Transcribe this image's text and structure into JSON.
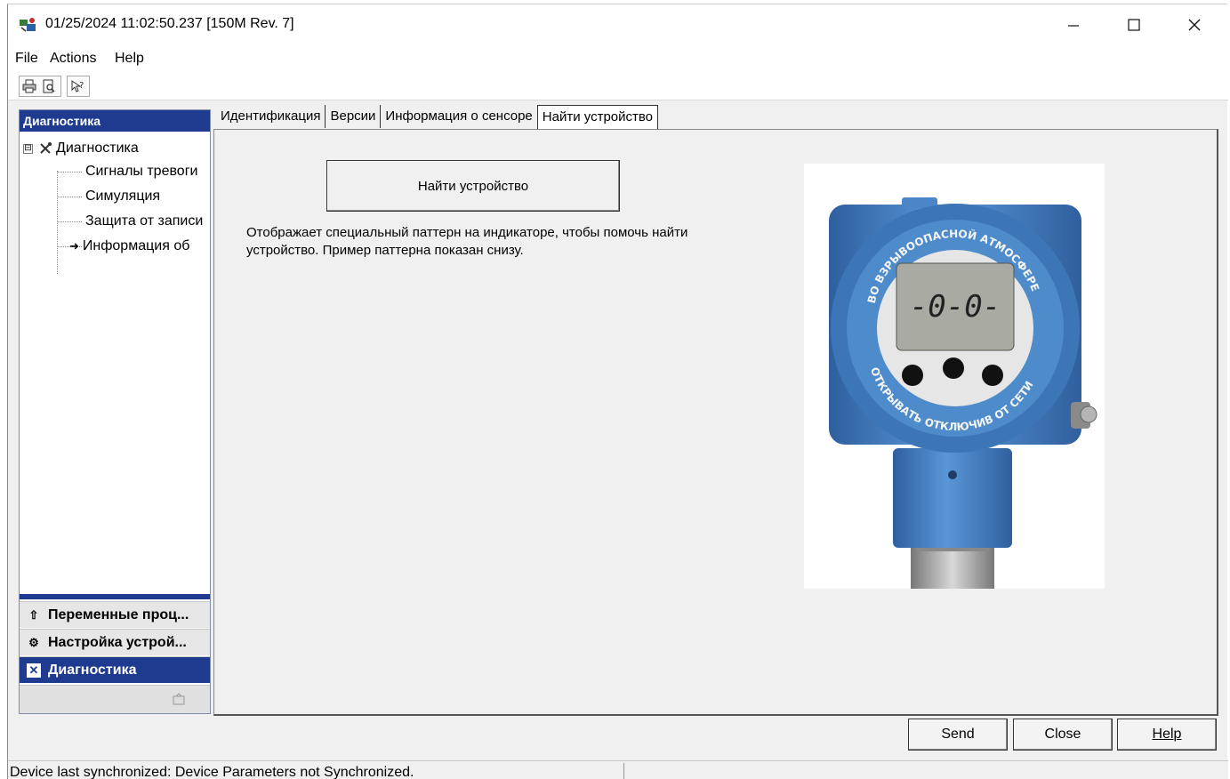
{
  "window": {
    "title": "01/25/2024 11:02:50.237 [150M Rev. 7]",
    "controls": {
      "minimize": "—",
      "maximize": "☐",
      "close": "✕"
    }
  },
  "menu": {
    "file": "File",
    "actions": "Actions",
    "help": "Help"
  },
  "toolbar": {
    "icons": [
      "print-icon",
      "print-preview-icon",
      "context-help-icon"
    ]
  },
  "left_panel": {
    "header": "Диагностика",
    "tree": {
      "root_label": "Диагностика",
      "expander": "⊟",
      "children": [
        {
          "label": "Сигналы тревоги"
        },
        {
          "label": "Симуляция"
        },
        {
          "label": "Защита от записи"
        },
        {
          "label": "Информация об"
        }
      ],
      "selected_marker": "➜"
    },
    "scroll": {
      "left": "‹",
      "right": "›"
    },
    "nav": [
      {
        "label": "Переменные проц...",
        "icon": "home-icon",
        "glyph": "⇧"
      },
      {
        "label": "Настройка устрой...",
        "icon": "gear-icon",
        "glyph": "⚙"
      },
      {
        "label": "Диагностика",
        "icon": "diagnostics-icon",
        "glyph": "✕"
      }
    ]
  },
  "tabs": [
    {
      "label": "Идентификация",
      "active": false
    },
    {
      "label": "Версии",
      "active": false
    },
    {
      "label": "Информация о сенсоре",
      "active": false
    },
    {
      "label": "Найти устройство",
      "active": true
    }
  ],
  "content": {
    "find_button_label": "Найти устройство",
    "description": "Отображает специальный паттерн на индикаторе, чтобы помочь найти устройство. Пример паттерна показан снизу.",
    "device_image": {
      "display_text": "-0-0-",
      "ring_text_top": "ВО ВЗРЫВООПАСНОЙ АТМОСФЕРЕ",
      "ring_text_bottom": "ОТКРЫВАТЬ ОТКЛЮЧИВ ОТ СЕТИ",
      "colors": {
        "body": "#4a86c8",
        "body_dark": "#2f5f9e",
        "lcd": "#a9aaa2"
      }
    }
  },
  "buttons": {
    "send": "Send",
    "close": "Close",
    "help": "Help"
  },
  "status": {
    "text": "Device last synchronized: Device Parameters not Synchronized."
  },
  "colors": {
    "accent": "#1f3b8f"
  }
}
